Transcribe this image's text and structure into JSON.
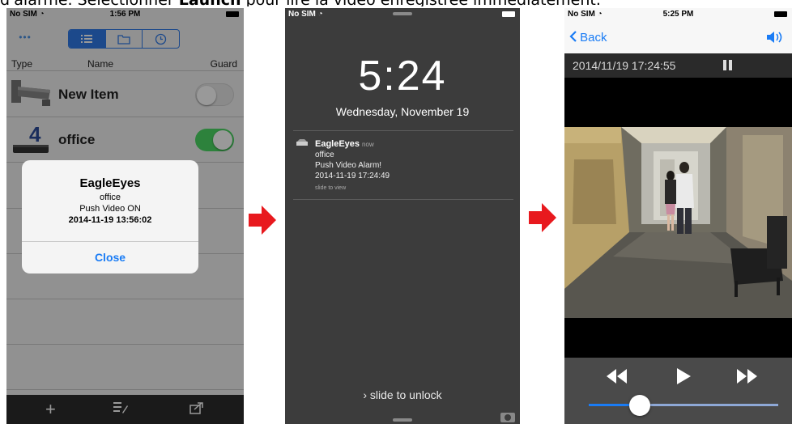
{
  "caption": {
    "lead": "d'alarme. Sélectionner ",
    "bold": "Launch",
    "tail": " pour lire la vidéo enregistrée immédiatement."
  },
  "colors": {
    "accent": "#1a7cf5",
    "toggle_on": "#4cd964",
    "arrow": "#e8191e"
  },
  "phone1": {
    "status": {
      "carrier": "No SIM",
      "time": "1:56 PM"
    },
    "columns": {
      "type": "Type",
      "name": "Name",
      "guard": "Guard"
    },
    "rows": [
      {
        "name": "New Item",
        "guard_on": false
      },
      {
        "name": "office",
        "guard_on": true
      }
    ],
    "alert": {
      "title": "EagleEyes",
      "line1": "office",
      "line2": "Push Video ON",
      "line3": "2014-11-19 13:56:02",
      "button": "Close"
    }
  },
  "phone2": {
    "status": {
      "carrier": "No SIM"
    },
    "time": "5:24",
    "date": "Wednesday, November 19",
    "notification": {
      "app": "EagleEyes",
      "when": "now",
      "line1": "office",
      "line2": "Push Video Alarm!",
      "line3": "2014-11-19 17:24:49",
      "hint": "slide to view"
    },
    "unlock": "slide to unlock"
  },
  "phone3": {
    "status": {
      "carrier": "No SIM",
      "time": "5:25 PM"
    },
    "back": "Back",
    "timestamp": "2014/11/19 17:24:55",
    "progress": 0.27
  }
}
